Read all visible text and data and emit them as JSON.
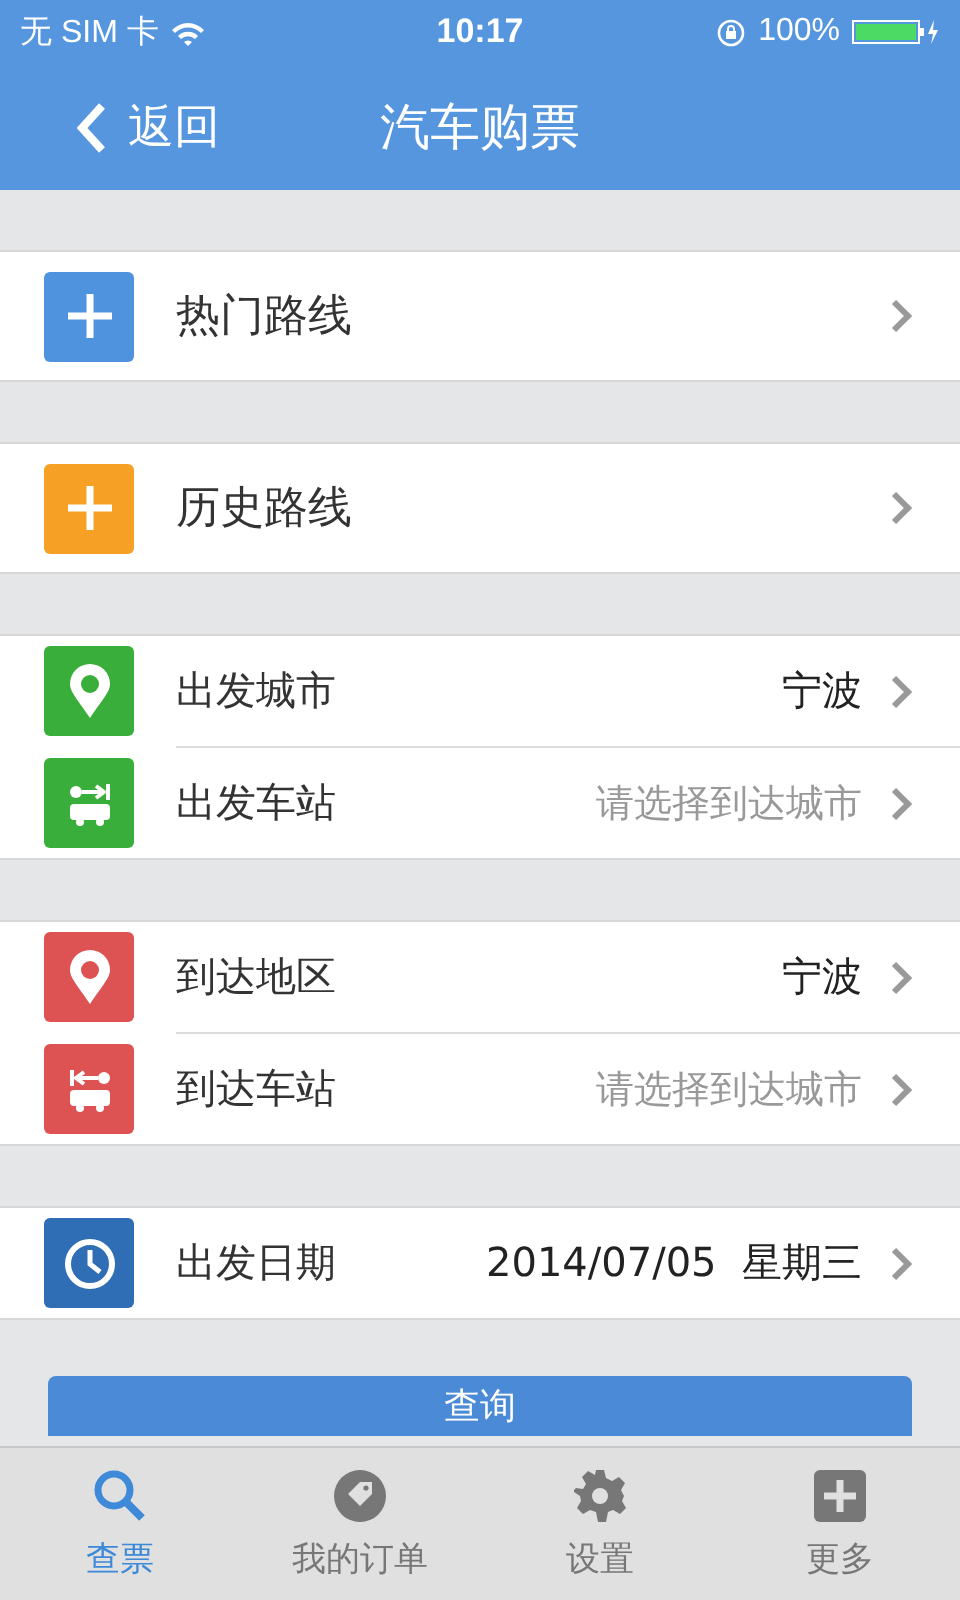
{
  "status_bar": {
    "carrier": "无 SIM 卡",
    "time": "10:17",
    "battery": "100%"
  },
  "nav": {
    "back": "返回",
    "title": "汽车购票"
  },
  "sections": [
    {
      "kind": "shortcut",
      "rows": [
        {
          "kind": "plus",
          "color": "#4f92de",
          "label": "热门路线"
        }
      ]
    },
    {
      "kind": "shortcut",
      "rows": [
        {
          "kind": "plus",
          "color": "#f6a125",
          "label": "历史路线"
        }
      ]
    },
    {
      "kind": "group",
      "rows": [
        {
          "kind": "pin",
          "color": "#3aae3a",
          "label": "出发城市",
          "value": "宁波"
        },
        {
          "kind": "bus-depart",
          "color": "#3aae3a",
          "label": "出发车站",
          "hint": "请选择到达城市"
        }
      ]
    },
    {
      "kind": "group",
      "rows": [
        {
          "kind": "pin",
          "color": "#dd5353",
          "label": "到达地区",
          "value": "宁波"
        },
        {
          "kind": "bus-arrive",
          "color": "#dd5353",
          "label": "到达车站",
          "hint": "请选择到达城市"
        }
      ]
    },
    {
      "kind": "group",
      "rows": [
        {
          "kind": "clock",
          "color": "#2f6db5",
          "label": "出发日期",
          "value": "2014/07/05  星期三"
        }
      ]
    }
  ],
  "query_button": "查询",
  "tabs": [
    {
      "kind": "search",
      "label": "查票",
      "selected": true
    },
    {
      "kind": "tag",
      "label": "我的订单",
      "selected": false
    },
    {
      "kind": "gear",
      "label": "设置",
      "selected": false
    },
    {
      "kind": "more",
      "label": "更多",
      "selected": false
    }
  ]
}
